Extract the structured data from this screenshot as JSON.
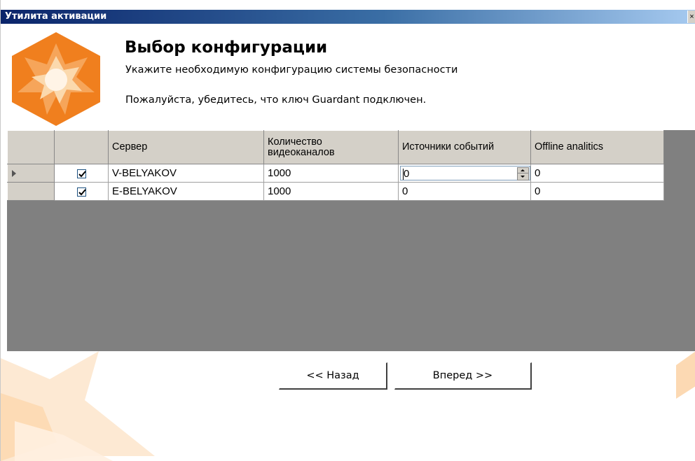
{
  "window": {
    "title": "Утилита активации",
    "close_label": "×"
  },
  "header": {
    "title": "Выбор конфигурации",
    "subtitle": "Укажите необходимую конфигурацию системы безопасности",
    "note": "Пожалуйста, убедитесь, что ключ Guardant подключен."
  },
  "grid": {
    "columns": [
      "",
      "",
      "Сервер",
      "Количество видеоканалов",
      "Источники событий",
      "Offline analitics"
    ],
    "column_header_lines": {
      "channels_line1": "Количество",
      "channels_line2": "видеоканалов"
    },
    "rows": [
      {
        "current": true,
        "checked": true,
        "server": "V-BELYAKOV",
        "channels": "1000",
        "event_sources": "0",
        "offline_analytics": "0"
      },
      {
        "current": false,
        "checked": true,
        "server": "E-BELYAKOV",
        "channels": "1000",
        "event_sources": "0",
        "offline_analytics": "0"
      }
    ]
  },
  "buttons": {
    "back": "<< Назад",
    "next": "Вперед >>"
  },
  "colors": {
    "logo_orange": "#f07f1e",
    "logo_light": "#fbd9ad",
    "grid_bg": "#808080",
    "header_bg": "#d4d0c8"
  }
}
